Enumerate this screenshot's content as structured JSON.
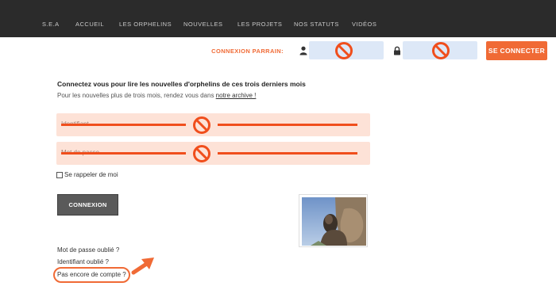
{
  "nav": {
    "items": [
      "S.E.A",
      "ACCUEIL",
      "LES ORPHELINS",
      "NOUVELLES",
      "LES PROJETS",
      "NOS STATUTS",
      "VIDÉOS"
    ]
  },
  "sponsor_login": {
    "label": "CONNEXION PARRAIN:",
    "user_icon": "user-icon",
    "lock_icon": "lock-icon",
    "submit_label": "SE CONNECTER"
  },
  "main": {
    "title": "Connectez vous pour lire les nouvelles d'orphelins de ces trois derniers mois",
    "subtitle_prefix": "Pour les nouvelles plus de trois mois, rendez vous dans ",
    "subtitle_link": "notre archive !",
    "username_placeholder": "Identifiant",
    "password_placeholder": "Mot de passe",
    "remember_label": "Se rappeler de moi",
    "login_button": "CONNEXION",
    "forgot_password": "Mot de passe oublié ?",
    "forgot_username": "Identifiant oublié ?",
    "no_account": "Pas encore de compte ?"
  },
  "colors": {
    "accent": "#f06a35",
    "nav_bg": "#2b2b2b",
    "field_top_bg": "#dde8f7",
    "field_main_bg": "#fde2d7",
    "login_btn_bg": "#5a5a5a"
  }
}
